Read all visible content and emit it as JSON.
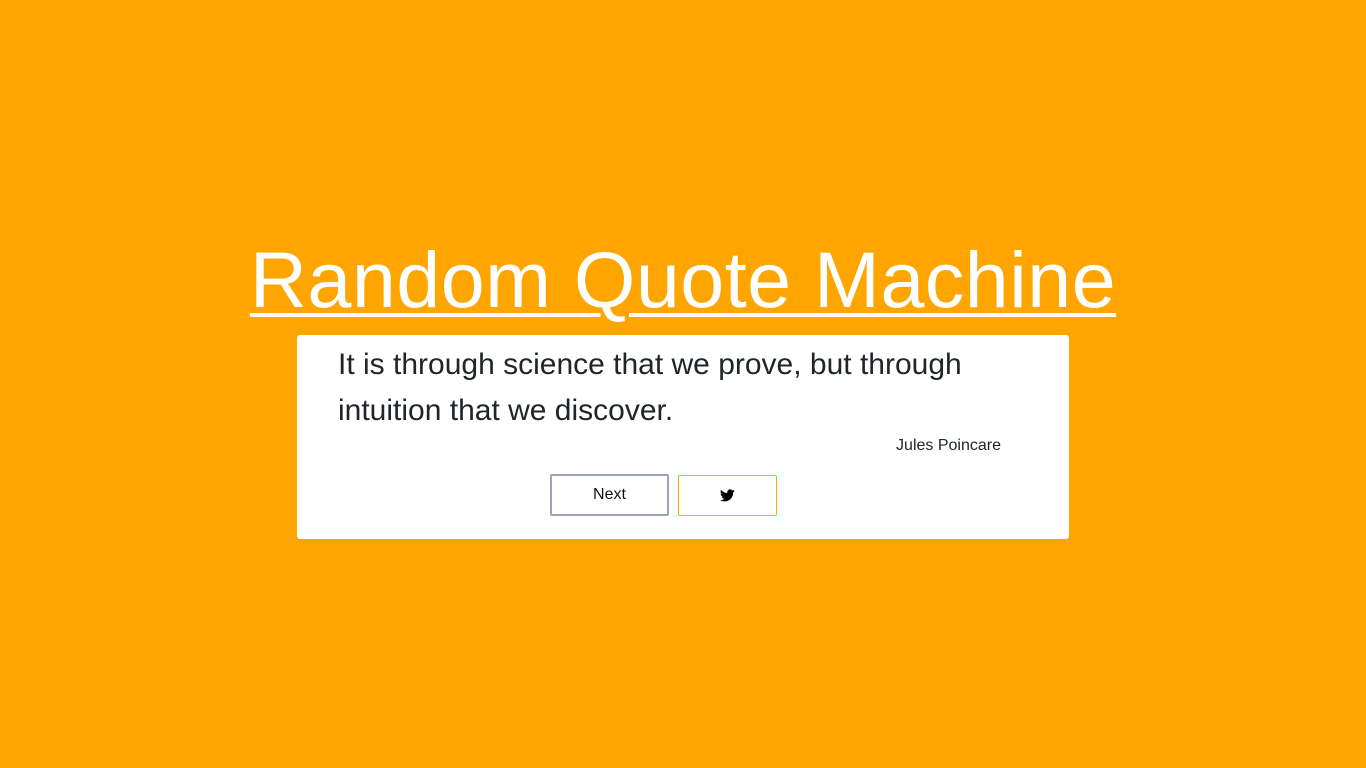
{
  "app": {
    "title": "Random Quote Machine"
  },
  "quote": {
    "text": "It is through science that we prove, but through intuition that we discover.",
    "author": "Jules Poincare"
  },
  "buttons": {
    "next_label": "Next",
    "tweet_icon": "twitter-icon"
  },
  "colors": {
    "background": "#FFA500",
    "card": "#FFFFFF",
    "text": "#212529"
  }
}
